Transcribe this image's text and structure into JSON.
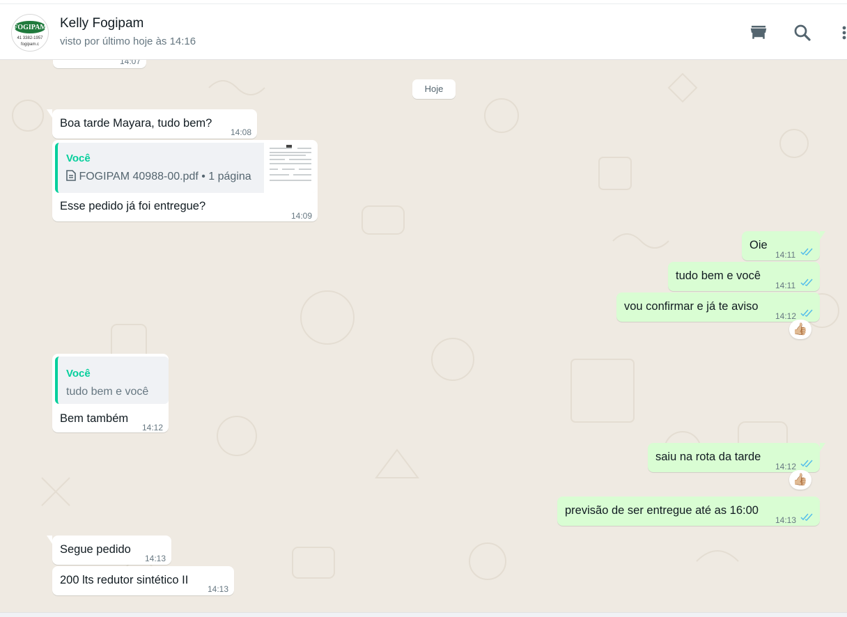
{
  "header": {
    "contact_name": "Kelly Fogipam",
    "status": "visto por último hoje às 14:16",
    "avatar_brand": "FOGIPAM",
    "avatar_phone": "41 3382-1957",
    "avatar_site": "fogipam.c"
  },
  "icons": [
    "catalog-store-icon",
    "search-icon",
    "menu-kebab-icon"
  ],
  "chat": {
    "partial_time": "14:07",
    "date_divider": "Hoje",
    "messages": [
      {
        "dir": "in",
        "text": "Boa tarde Mayara, tudo bem?",
        "time": "14:08"
      },
      {
        "dir": "in",
        "quote_author": "Você",
        "quote_text": "FOGIPAM 40988-00.pdf • 1 página",
        "text": "Esse pedido já foi entregue?",
        "time": "14:09"
      },
      {
        "dir": "out",
        "text": "Oie",
        "time": "14:11",
        "status": "read"
      },
      {
        "dir": "out",
        "text": "tudo bem e você",
        "time": "14:11",
        "status": "read"
      },
      {
        "dir": "out",
        "text": "vou confirmar e já te aviso",
        "time": "14:12",
        "status": "read",
        "reaction": "👍🏼"
      },
      {
        "dir": "in",
        "quote_author": "Você",
        "quote_text": "tudo bem e você",
        "text": "Bem também",
        "time": "14:12"
      },
      {
        "dir": "out",
        "text": "saiu na rota da tarde",
        "time": "14:12",
        "status": "read",
        "reaction": "👍🏼"
      },
      {
        "dir": "out",
        "text": "previsão de ser entregue até as 16:00",
        "time": "14:13",
        "status": "read"
      },
      {
        "dir": "in",
        "text": "Segue pedido",
        "time": "14:13"
      },
      {
        "dir": "in",
        "text": "200 lts redutor sintético II",
        "time": "14:13"
      }
    ]
  },
  "colors": {
    "chat_background": "#efeae2",
    "incoming_bubble": "#ffffff",
    "outgoing_bubble": "#d9fdd3",
    "quote_accent": "#06cf9c",
    "read_ticks": "#53bdeb",
    "secondary_text": "#667781"
  }
}
